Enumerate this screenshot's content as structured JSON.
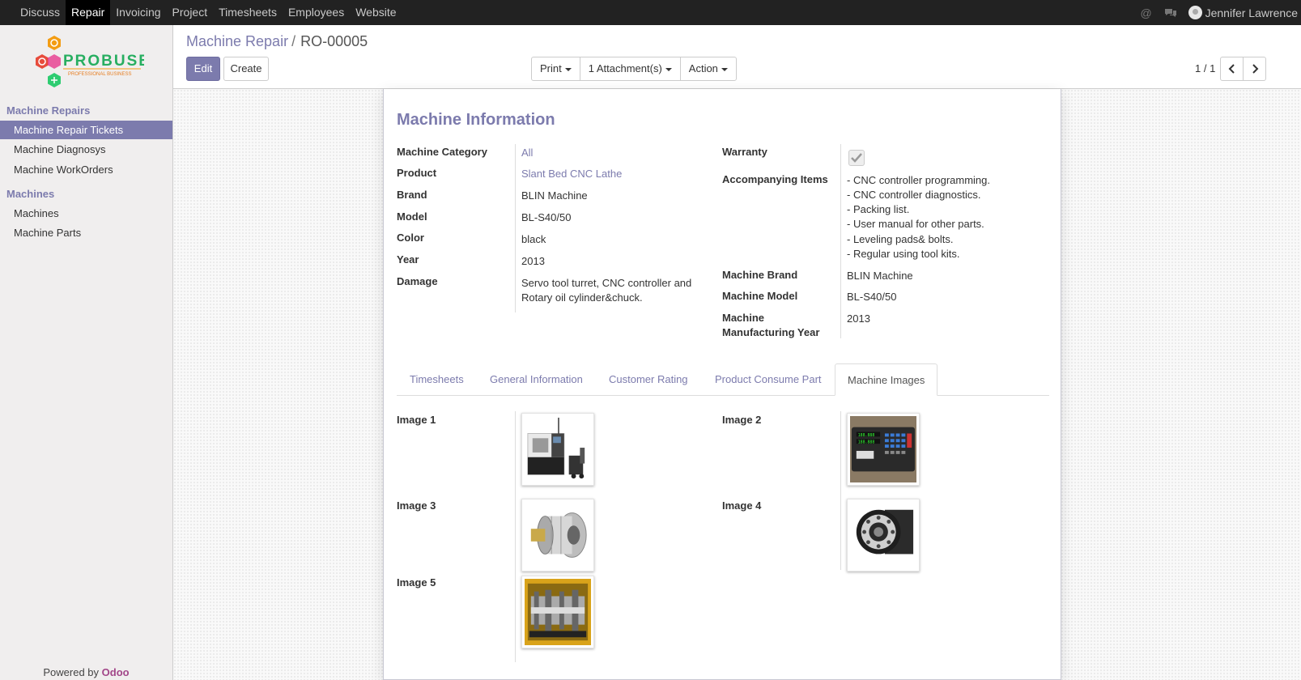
{
  "topbar": {
    "menu": [
      "Discuss",
      "Repair",
      "Invoicing",
      "Project",
      "Timesheets",
      "Employees",
      "Website"
    ],
    "active_index": 1,
    "user_name": "Jennifer Lawrence",
    "icons": [
      "at-icon",
      "chat-icon"
    ]
  },
  "sidebar": {
    "logo_text": "PROBUSE",
    "logo_subtext": "PROFESSIONAL BUSINESS",
    "section1": "Machine Repairs",
    "section1_items": [
      "Machine Repair Tickets",
      "Machine Diagnosys",
      "Machine WorkOrders"
    ],
    "section2": "Machines",
    "section2_items": [
      "Machines",
      "Machine Parts"
    ],
    "powered_prefix": "Powered by",
    "powered_brand": "Odoo"
  },
  "control": {
    "breadcrumb_parent": "Machine Repair",
    "breadcrumb_sep": "/",
    "breadcrumb_current": "RO-00005",
    "edit_label": "Edit",
    "create_label": "Create",
    "print_label": "Print",
    "attachments_label": "1 Attachment(s)",
    "action_label": "Action",
    "pager": "1 / 1"
  },
  "form": {
    "title": "Machine Information",
    "left_fields": [
      {
        "label": "Machine Category",
        "value": "All"
      },
      {
        "label": "Product",
        "value": "Slant Bed CNC Lathe"
      },
      {
        "label": "Brand",
        "value": "BLIN Machine"
      },
      {
        "label": "Model",
        "value": "BL-S40/50"
      },
      {
        "label": "Color",
        "value": "black"
      },
      {
        "label": "Year",
        "value": "2013"
      },
      {
        "label": "Damage",
        "value_line1": "Servo tool turret, CNC controller and",
        "value_line2": "Rotary oil cylinder&chuck."
      }
    ],
    "warranty_label": "Warranty",
    "warranty_checked": true,
    "accompanying_label": "Accompanying Items",
    "accompanying_items": [
      "- CNC controller programming.",
      "- CNC controller diagnostics.",
      "- Packing list.",
      "- User manual for other parts.",
      "- Leveling pads& bolts.",
      "- Regular using tool kits."
    ],
    "machine_brand_label": "Machine Brand",
    "machine_brand": "BLIN Machine",
    "machine_model_label": "Machine Model",
    "machine_model": "BL-S40/50",
    "mfg_year_label_1": "Machine",
    "mfg_year_label_2": "Manufacturing Year",
    "mfg_year": "2013"
  },
  "tabs": [
    "Timesheets",
    "General Information",
    "Customer Rating",
    "Product Consume Part",
    "Machine Images"
  ],
  "active_tab": "Machine Images",
  "images": {
    "labels": [
      "Image 1",
      "Image 2",
      "Image 3",
      "Image 4",
      "Image 5"
    ]
  },
  "colors": {
    "accent": "#7c7bad",
    "topbar": "#222222",
    "odoo": "#a24689"
  }
}
